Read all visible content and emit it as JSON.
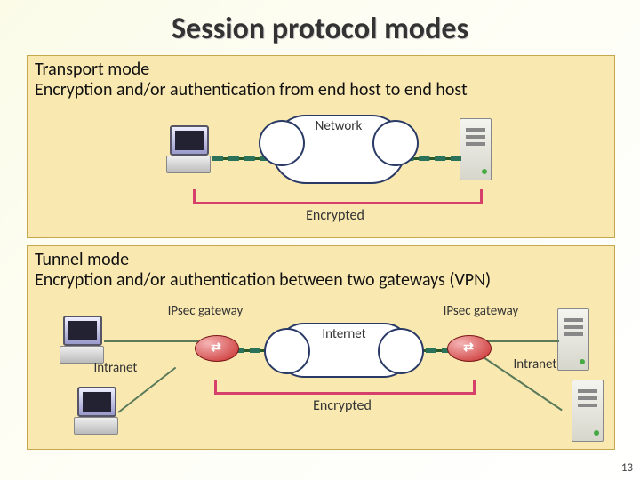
{
  "title": "Session protocol modes",
  "page_number": "13",
  "transport": {
    "heading_line1": "Transport mode",
    "heading_line2": "Encryption and/or authentication from end host to end host",
    "cloud_label": "Network",
    "encrypted_label": "Encrypted"
  },
  "tunnel": {
    "heading_line1": "Tunnel mode",
    "heading_line2": "Encryption and/or authentication between two gateways (VPN)",
    "left_gateway_label": "IPsec gateway",
    "right_gateway_label": "IPsec gateway",
    "left_net_label": "Intranet",
    "right_net_label": "Intranet",
    "cloud_label": "Internet",
    "encrypted_label": "Encrypted"
  },
  "icons": {
    "pc": "desktop-pc",
    "server": "server-tower",
    "router": "router",
    "cloud": "network-cloud"
  }
}
